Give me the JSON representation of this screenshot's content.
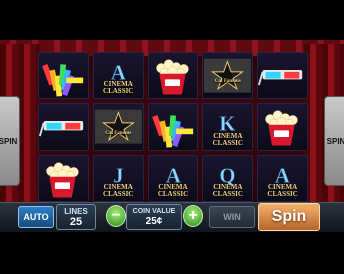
{
  "side_left_label": "SPIN",
  "side_right_label": "SPIN",
  "reels": [
    [
      "film-strip",
      "letter-a-cinema",
      "popcorn",
      "walk-of-fame-star",
      "3d-glasses"
    ],
    [
      "3d-glasses",
      "walk-of-fame-star",
      "film-strip",
      "letter-k-cinema",
      "popcorn"
    ],
    [
      "popcorn",
      "letter-j-cinema",
      "letter-a-cinema",
      "letter-q-cinema",
      "letter-a-cinema"
    ]
  ],
  "star_text": "Cat Famous",
  "cinema_text": "CINEMA",
  "classic_text": "CLASSIC",
  "controls": {
    "auto_label": "AUTO",
    "lines_label": "LINES",
    "lines_value": "25",
    "coin_label": "COIN VALUE",
    "coin_value": "25¢",
    "minus_label": "−",
    "plus_label": "+",
    "win_label": "WIN",
    "spin_label": "Spin"
  },
  "colors": {
    "curtain": "#8c1018",
    "gold": "#f2d27a",
    "spin_button": "#e08a45",
    "auto_button": "#2b7ec8",
    "plus_minus": "#49b52a"
  }
}
